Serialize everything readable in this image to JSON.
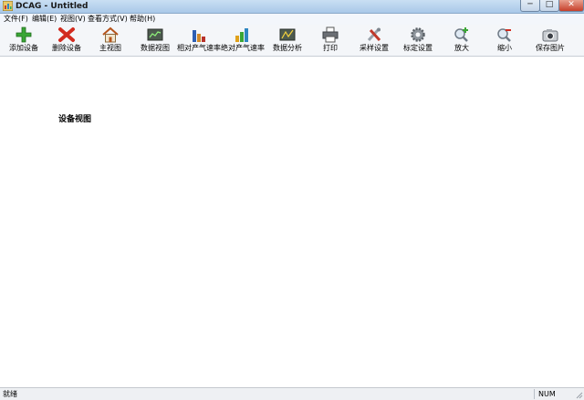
{
  "window": {
    "title": "DCAG - Untitled",
    "min_glyph": "─",
    "max_glyph": "□",
    "close_glyph": "✕"
  },
  "menu": [
    "文件(F)",
    "编辑(E)",
    "视图(V)",
    "查看方式(V)",
    "帮助(H)"
  ],
  "toolbar": [
    {
      "label": "添加设备",
      "icon": "add-icon"
    },
    {
      "label": "删除设备",
      "icon": "delete-icon"
    },
    {
      "label": "主视图",
      "icon": "home-icon"
    },
    {
      "label": "数据视图",
      "icon": "data-view-icon"
    },
    {
      "label": "相对产气速率",
      "icon": "bar-chart-icon"
    },
    {
      "label": "绝对产气速率",
      "icon": "bar-chart-color-icon"
    },
    {
      "label": "数据分析",
      "icon": "analysis-icon"
    },
    {
      "label": "打印",
      "icon": "printer-icon"
    },
    {
      "label": "采样设置",
      "icon": "tools-icon"
    },
    {
      "label": "标定设置",
      "icon": "gear-icon"
    },
    {
      "label": "放大",
      "icon": "zoom-in-icon"
    },
    {
      "label": "缩小",
      "icon": "zoom-out-icon"
    },
    {
      "label": "保存图片",
      "icon": "camera-icon"
    }
  ],
  "main": {
    "view_title": "设备视图"
  },
  "status": {
    "text": "就绪",
    "num": "NUM"
  }
}
